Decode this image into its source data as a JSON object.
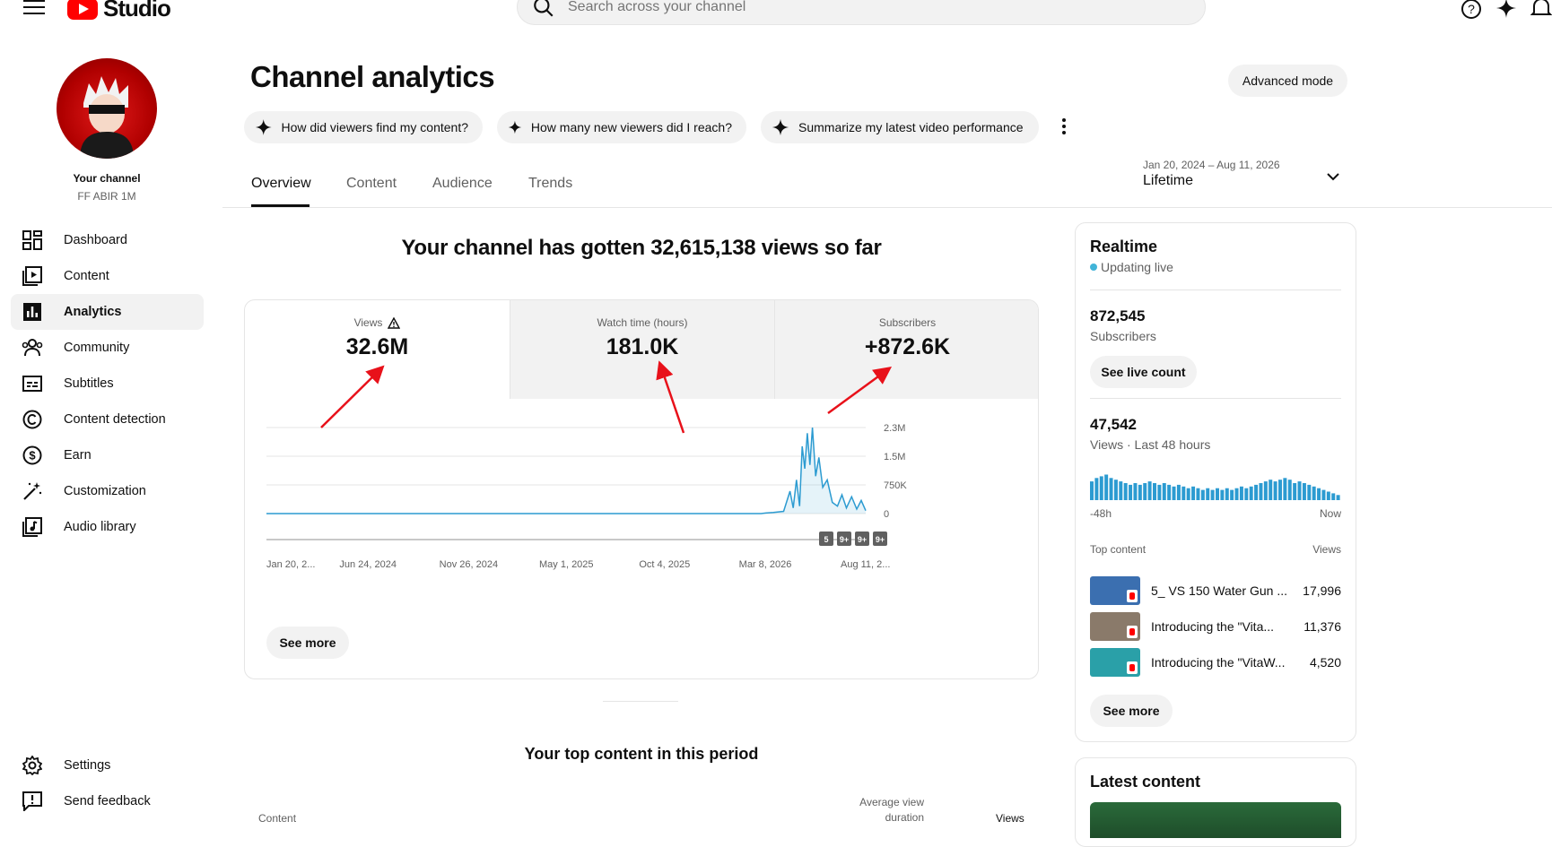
{
  "app": {
    "logo_text": "Studio",
    "search_placeholder": "Search across your channel"
  },
  "sidebar": {
    "your_channel": "Your channel",
    "channel_name": "FF ABIR 1M",
    "items": [
      {
        "label": "Dashboard",
        "icon": "dashboard-icon"
      },
      {
        "label": "Content",
        "icon": "content-icon"
      },
      {
        "label": "Analytics",
        "icon": "analytics-icon",
        "active": true
      },
      {
        "label": "Community",
        "icon": "community-icon"
      },
      {
        "label": "Subtitles",
        "icon": "subtitles-icon"
      },
      {
        "label": "Content detection",
        "icon": "copyright-icon"
      },
      {
        "label": "Earn",
        "icon": "dollar-icon"
      },
      {
        "label": "Customization",
        "icon": "magic-wand-icon"
      },
      {
        "label": "Audio library",
        "icon": "audio-library-icon"
      }
    ],
    "settings": "Settings",
    "send_feedback": "Send feedback"
  },
  "header": {
    "title": "Channel analytics",
    "advanced_mode": "Advanced mode",
    "chips": [
      "How did viewers find my content?",
      "How many new viewers did I reach?",
      "Summarize my latest video performance"
    ],
    "tabs": [
      "Overview",
      "Content",
      "Audience",
      "Trends"
    ],
    "date_range": "Jan 20, 2024 – Aug 11, 2026",
    "date_label": "Lifetime"
  },
  "main": {
    "headline": "Your channel has gotten 32,615,138 views so far",
    "metrics": [
      {
        "label": "Views",
        "value": "32.6M"
      },
      {
        "label": "Watch time (hours)",
        "value": "181.0K"
      },
      {
        "label": "Subscribers",
        "value": "+872.6K"
      }
    ],
    "see_more": "See more",
    "top_content_title": "Your top content in this period",
    "table_headers": {
      "content": "Content",
      "avg_view_line1": "Average view",
      "avg_view_line2": "duration",
      "views": "Views"
    }
  },
  "chart_data": {
    "type": "line",
    "x_labels": [
      "Jan 20, 2...",
      "Jun 24, 2024",
      "Nov 26, 2024",
      "May 1, 2025",
      "Oct 4, 2025",
      "Mar 8, 2026",
      "Aug 11, 2..."
    ],
    "y_labels": [
      "2.3M",
      "1.5M",
      "750K",
      "0"
    ],
    "ylim": [
      0,
      2300000
    ],
    "series": [
      {
        "color": "#2c9bd1",
        "points": [
          [
            "2024-01-20",
            0
          ],
          [
            "2026-03-01",
            0
          ],
          [
            "2026-03-08",
            15000
          ],
          [
            "2026-03-20",
            30000
          ],
          [
            "2026-04-05",
            60000
          ],
          [
            "2026-04-15",
            600000
          ],
          [
            "2026-04-20",
            150000
          ],
          [
            "2026-04-25",
            900000
          ],
          [
            "2026-04-30",
            200000
          ],
          [
            "2026-05-04",
            1800000
          ],
          [
            "2026-05-08",
            1200000
          ],
          [
            "2026-05-12",
            2150000
          ],
          [
            "2026-05-16",
            1300000
          ],
          [
            "2026-05-20",
            2300000
          ],
          [
            "2026-05-25",
            1000000
          ],
          [
            "2026-05-30",
            1500000
          ],
          [
            "2026-06-05",
            700000
          ],
          [
            "2026-06-12",
            900000
          ],
          [
            "2026-06-20",
            300000
          ],
          [
            "2026-06-28",
            200000
          ],
          [
            "2026-07-05",
            500000
          ],
          [
            "2026-07-12",
            150000
          ],
          [
            "2026-07-20",
            450000
          ],
          [
            "2026-07-28",
            120000
          ],
          [
            "2026-08-04",
            350000
          ],
          [
            "2026-08-11",
            80000
          ]
        ]
      }
    ],
    "markers": [
      "5",
      "9+",
      "9+",
      "9+"
    ],
    "grid": true
  },
  "realtime": {
    "title": "Realtime",
    "status": "Updating live",
    "subscribers_value": "872,545",
    "subscribers_label": "Subscribers",
    "see_live_count": "See live count",
    "views_value": "47,542",
    "views_label": "Views · Last 48 hours",
    "bars": [
      0.55,
      0.65,
      0.7,
      0.75,
      0.65,
      0.6,
      0.55,
      0.5,
      0.45,
      0.5,
      0.45,
      0.5,
      0.55,
      0.5,
      0.45,
      0.5,
      0.45,
      0.4,
      0.45,
      0.4,
      0.35,
      0.4,
      0.35,
      0.3,
      0.35,
      0.3,
      0.35,
      0.3,
      0.35,
      0.3,
      0.35,
      0.4,
      0.35,
      0.4,
      0.45,
      0.5,
      0.55,
      0.6,
      0.55,
      0.6,
      0.65,
      0.6,
      0.5,
      0.55,
      0.5,
      0.45,
      0.4,
      0.35,
      0.3,
      0.25,
      0.2,
      0.15
    ],
    "axis_start": "-48h",
    "axis_end": "Now",
    "top_content_label": "Top content",
    "views_col": "Views",
    "items": [
      {
        "title": "5_ VS 150 Water Gun ...",
        "views": "17,996",
        "thumb": "#3b6fb0"
      },
      {
        "title": "Introducing the \"Vita...",
        "views": "11,376",
        "thumb": "#8a7a6a"
      },
      {
        "title": "Introducing the \"VitaW...",
        "views": "4,520",
        "thumb": "#2aa0a8"
      }
    ],
    "see_more": "See more",
    "latest_title": "Latest content"
  }
}
